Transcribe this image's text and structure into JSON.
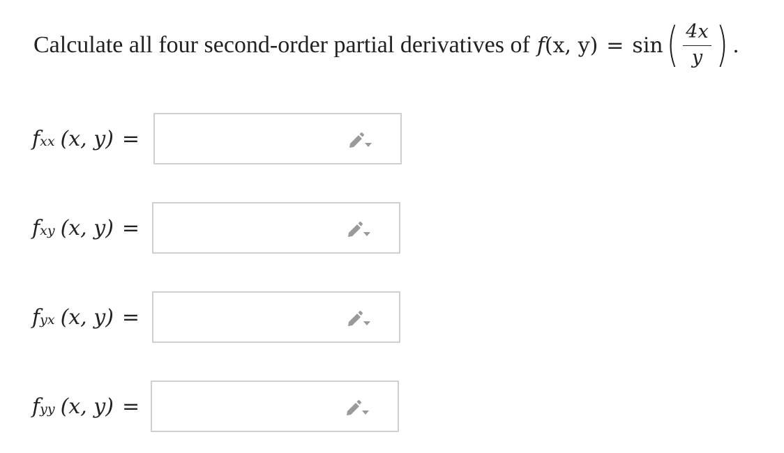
{
  "question": {
    "prompt": "Calculate all four second-order partial derivatives of",
    "func_name": "f",
    "func_args": "(x, y)",
    "equals": "=",
    "sin": "sin",
    "numerator": "4x",
    "denominator": "y",
    "period": "."
  },
  "derivatives": [
    {
      "f": "f",
      "subscript": "xx",
      "args": "(x, y)",
      "equals": "=",
      "value": "",
      "icon": "pencil-dropdown-icon"
    },
    {
      "f": "f",
      "subscript": "xy",
      "args": "(x, y)",
      "equals": "=",
      "value": "",
      "icon": "pencil-dropdown-icon"
    },
    {
      "f": "f",
      "subscript": "yx",
      "args": "(x, y)",
      "equals": "=",
      "value": "",
      "icon": "pencil-dropdown-icon"
    },
    {
      "f": "f",
      "subscript": "yy",
      "args": "(x, y)",
      "equals": "=",
      "value": "",
      "icon": "pencil-dropdown-icon"
    }
  ],
  "colors": {
    "text": "#222222",
    "box_border": "#cfcfcf",
    "icon": "#9a9a9a"
  }
}
